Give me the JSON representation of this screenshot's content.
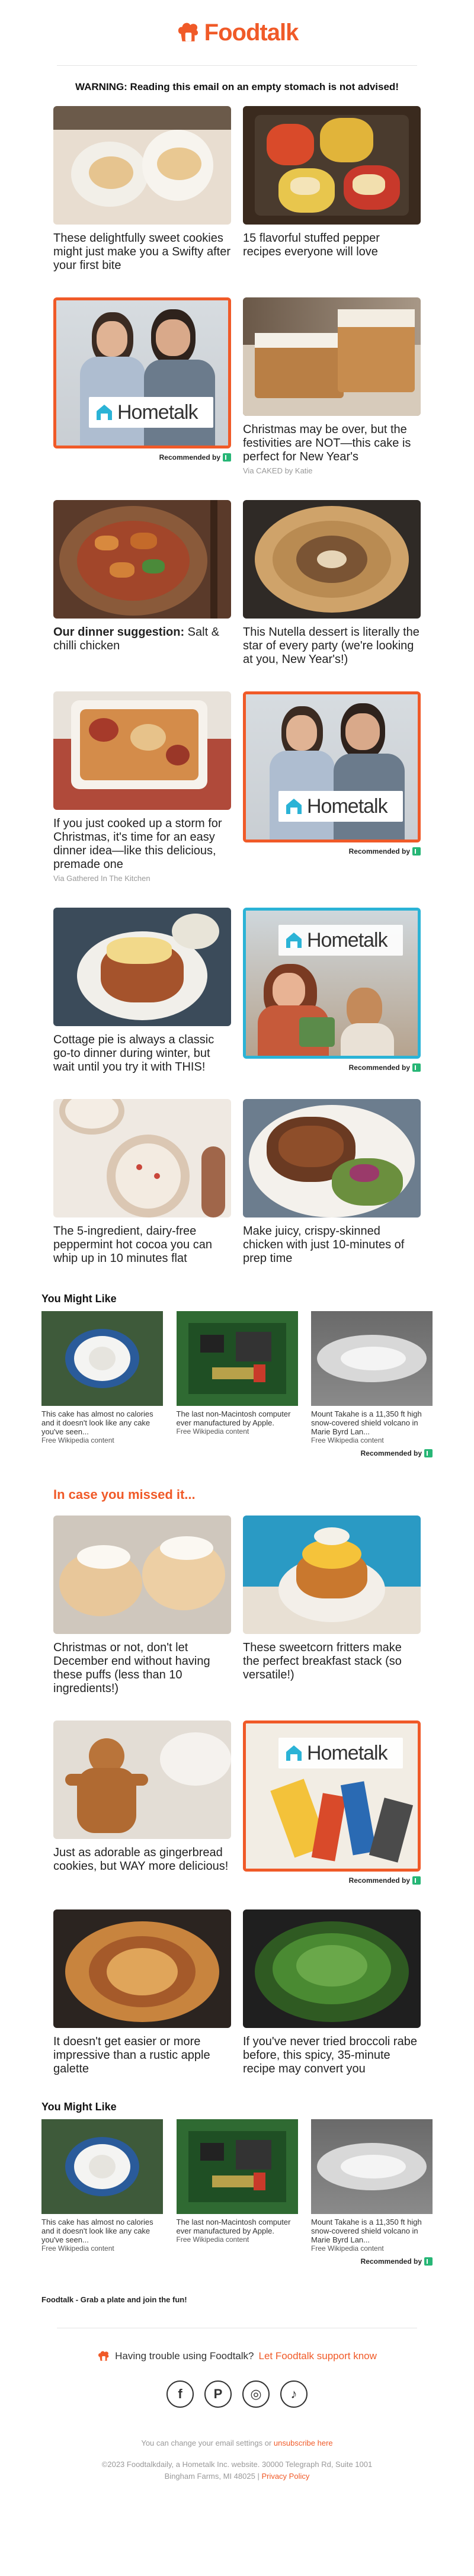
{
  "header": {
    "brand": "Foodtalk",
    "brand_color": "#f05a28"
  },
  "warning": "WARNING: Reading this email on an empty stomach is not advised!",
  "rows1": [
    {
      "left": {
        "caption": "These delightfully sweet cookies might just make you a Swifty after your first bite"
      },
      "right": {
        "caption": "15 flavorful stuffed pepper recipes everyone will love"
      }
    },
    {
      "left_ad": {
        "brand": "Hometalk",
        "recommended": "Recommended by"
      },
      "right": {
        "caption": "Christmas may be over, but the festivities are NOT—this cake is perfect for New Year's",
        "via": "Via CAKED by Katie"
      }
    },
    {
      "left": {
        "caption_bold": "Our dinner suggestion:",
        "caption": " Salt & chilli chicken"
      },
      "right": {
        "caption": "This Nutella dessert is literally the star of every party (we're looking at you, New Year's!)"
      }
    },
    {
      "left": {
        "caption": "If you just cooked up a storm for Christmas, it's time for an easy dinner idea—like this delicious, premade one",
        "via": "Via Gathered In The Kitchen"
      },
      "right_ad": {
        "brand": "Hometalk",
        "recommended": "Recommended by"
      }
    },
    {
      "left": {
        "caption": "Cottage pie is always a classic go-to dinner during winter, but wait until you try it with THIS!"
      },
      "right_ad": {
        "brand": "Hometalk",
        "recommended": "Recommended by"
      }
    },
    {
      "left": {
        "caption": "The 5-ingredient, dairy-free peppermint hot cocoa you can whip up in 10 minutes flat"
      },
      "right": {
        "caption": "Make juicy, crispy-skinned chicken with just 10-minutes of prep time"
      }
    }
  ],
  "you_might_like": {
    "title": "You Might Like",
    "items": [
      {
        "caption": "This cake has almost no calories and it doesn't look like any cake you've seen...",
        "source": "Free Wikipedia content"
      },
      {
        "caption": "The last non-Macintosh computer ever manufactured by Apple.",
        "source": "Free Wikipedia content"
      },
      {
        "caption": "Mount Takahe is a 11,350 ft high snow-covered shield volcano in Marie Byrd Lan...",
        "source": "Free Wikipedia content"
      }
    ],
    "recommended": "Recommended by"
  },
  "missed": {
    "title": "In case you missed it...",
    "rows": [
      {
        "left": {
          "caption": "Christmas or not, don't let December end without having these puffs (less than 10 ingredients!)"
        },
        "right": {
          "caption": "These sweetcorn fritters make the perfect breakfast stack (so versatile!)"
        }
      },
      {
        "left": {
          "caption": "Just as adorable as gingerbread cookies, but WAY more delicious!"
        },
        "right_ad": {
          "brand": "Hometalk",
          "recommended": "Recommended by"
        }
      },
      {
        "left": {
          "caption": "It doesn't get easier or more impressive than a rustic apple galette"
        },
        "right": {
          "caption": "If you've never tried broccoli rabe before, this spicy, 35-minute recipe may convert you"
        }
      }
    ]
  },
  "footer": {
    "tagline": "Foodtalk - Grab a plate and join the fun!",
    "trouble_text": "Having trouble using Foodtalk?",
    "trouble_link": "Let Foodtalk support know",
    "socials": [
      "f",
      "P",
      "◎",
      "♪"
    ],
    "settings_text": "You can change your email settings or",
    "unsubscribe": "unsubscribe here",
    "copyright": "©2023 Foodtalkdaily, a Hometalk Inc. website. 30000 Telegraph Rd, Suite 1001",
    "address": "Bingham Farms, MI 48025",
    "privacy": "Privacy Policy"
  }
}
